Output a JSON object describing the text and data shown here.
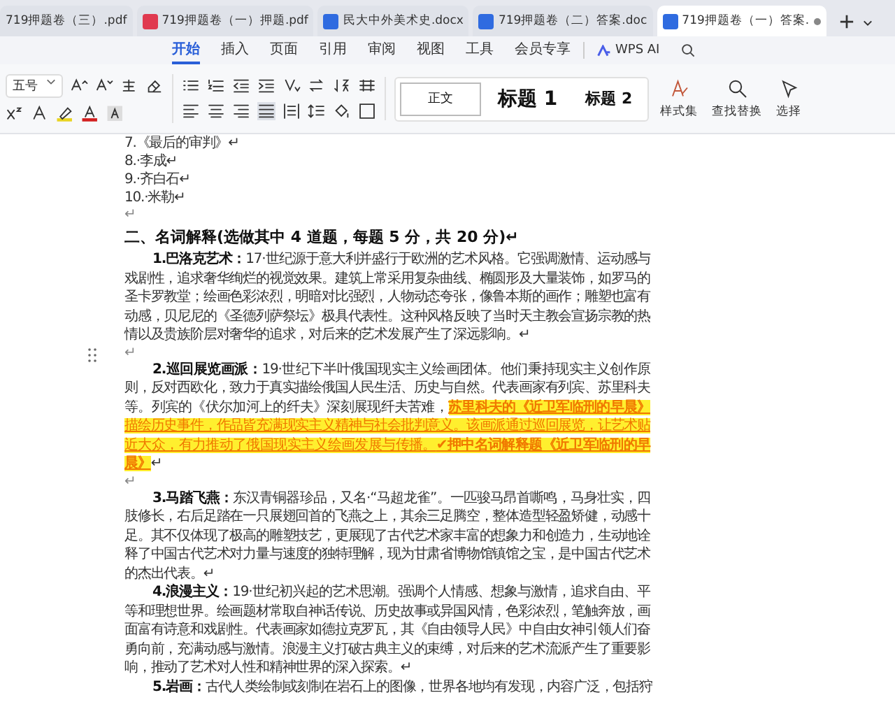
{
  "tabs": [
    {
      "label": "719押题卷（三）.pdf",
      "kind": "none",
      "selected": false
    },
    {
      "label": "719押题卷（一）押题.pdf",
      "kind": "pdf",
      "selected": false
    },
    {
      "label": "民大中外美术史.docx",
      "kind": "word",
      "selected": false
    },
    {
      "label": "719押题卷（二）答案.doc",
      "kind": "word",
      "selected": false
    },
    {
      "label": "719押题卷（一）答案.",
      "kind": "word",
      "selected": true
    }
  ],
  "menu": [
    {
      "label": "开始",
      "selected": true
    },
    {
      "label": "插入",
      "selected": false
    },
    {
      "label": "页面",
      "selected": false
    },
    {
      "label": "引用",
      "selected": false
    },
    {
      "label": "审阅",
      "selected": false
    },
    {
      "label": "视图",
      "selected": false
    },
    {
      "label": "工具",
      "selected": false
    },
    {
      "label": "会员专享",
      "selected": false
    }
  ],
  "ai_button": "WPS AI",
  "font_size": "五号",
  "styles": [
    {
      "label": "正文",
      "kind": "normal",
      "selected": true
    },
    {
      "label": "标题 1",
      "kind": "h1",
      "selected": false
    },
    {
      "label": "标题 2",
      "kind": "h2",
      "selected": false
    }
  ],
  "right_buttons": [
    {
      "label": "样式集",
      "kind": "styles"
    },
    {
      "label": "查找替换",
      "kind": "find"
    },
    {
      "label": "选择",
      "kind": "select"
    }
  ],
  "document": [
    {
      "kind": "item",
      "text": "7.《最后的审判》↵"
    },
    {
      "kind": "item",
      "text": "8.·李成↵"
    },
    {
      "kind": "item",
      "text": "9.·齐白石↵"
    },
    {
      "kind": "item",
      "text": "10.·米勒↵"
    },
    {
      "kind": "mark",
      "text": "↵"
    },
    {
      "kind": "heading",
      "text": "二、名词解释(选做其中 4 道题，每题 5 分，共 20 分)↵"
    },
    {
      "kind": "term",
      "term": "1.巴洛克艺术：",
      "text": "17·世纪源于意大利并盛行于欧洲的艺术风格。它强调激情、运动感与戏剧性，追求奢华绚烂的视觉效果。建筑上常采用复杂曲线、椭圆形及大量装饰，如罗马的圣卡罗教堂；绘画色彩浓烈，明暗对比强烈，人物动态夸张，像鲁本斯的画作；雕塑也富有动感，贝尼尼的《圣德列萨祭坛》极具代表性。这种风格反映了当时天主教会宣扬宗教的热情以及贵族阶层对奢华的追求，对后来的艺术发展产生了深远影响。↵"
    },
    {
      "kind": "mark",
      "text": "↵"
    },
    {
      "kind": "term",
      "term": "2.巡回展览画派：",
      "text": "19·世纪下半叶俄国现实主义绘画团体。他们秉持现实主义创作原则，反对西欧化，致力于真实描绘俄国人民生活、历史与自然。代表画家有列宾、苏里科夫等。列宾的《伏尔加河上的纤夫》深刻展现纤夫苦难，",
      "highlight": "**苏里科夫的《近卫军临刑的早晨》**描绘历史事件，作品皆充满现实主义精神与社会批判意义。该画派通过巡回展览，让艺术贴近大众，有力推动了俄国现实主义绘画发展与传播。**✔押中名词解释题《近卫军临刑的早晨》**",
      "after": "↵"
    },
    {
      "kind": "mark",
      "text": "↵"
    },
    {
      "kind": "term",
      "term": "3.马踏飞燕：",
      "text": "东汉青铜器珍品，又名·“马超龙雀”。一匹骏马昂首嘶鸣，马身壮实，四肢修长，右后足踏在一只展翅回首的飞燕之上，其余三足腾空，整体造型轻盈矫健，动感十足。其不仅体现了极高的雕塑技艺，更展现了古代艺术家丰富的想象力和创造力，生动地诠释了中国古代艺术对力量与速度的独特理解，现为甘肃省博物馆镇馆之宝，是中国古代艺术的杰出代表。↵"
    },
    {
      "kind": "term",
      "term": "4.浪漫主义：",
      "text": "19·世纪初兴起的艺术思潮。强调个人情感、想象与激情，追求自由、平等和理想世界。绘画题材常取自神话传说、历史故事或异国风情，色彩浓烈，笔触奔放，画面富有诗意和戏剧性。代表画家如德拉克罗瓦，其《自由领导人民》中自由女神引领人们奋勇向前，充满动感与激情。浪漫主义打破古典主义的束缚，对后来的艺术流派产生了重要影响，推动了艺术对人性和精神世界的深入探索。↵"
    },
    {
      "kind": "term",
      "term": "5.岩画：",
      "text": "古代人类绘制或刻制在岩石上的图像，世界各地均有发现，内容广泛，包括狩"
    }
  ]
}
